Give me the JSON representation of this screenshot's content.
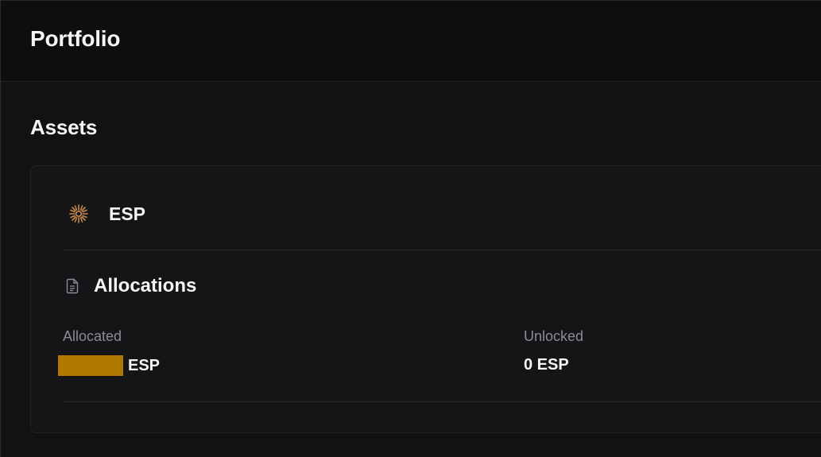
{
  "header": {
    "title": "Portfolio"
  },
  "assets": {
    "title": "Assets",
    "token": {
      "symbol": "ESP",
      "icon": "esp-sunburst-icon",
      "icon_color": "#c98a4a"
    },
    "allocations": {
      "title": "Allocations",
      "icon": "document-icon",
      "allocated": {
        "label": "Allocated",
        "value_unit": "ESP",
        "value_redacted": true,
        "redaction_color": "#b07800"
      },
      "unlocked": {
        "label": "Unlocked",
        "value": "0 ESP"
      }
    }
  },
  "colors": {
    "background": "#121214",
    "header_background": "#0e0e10",
    "card_background": "#151518",
    "text_primary": "#f5f5f7",
    "text_muted": "#8b8b94"
  }
}
